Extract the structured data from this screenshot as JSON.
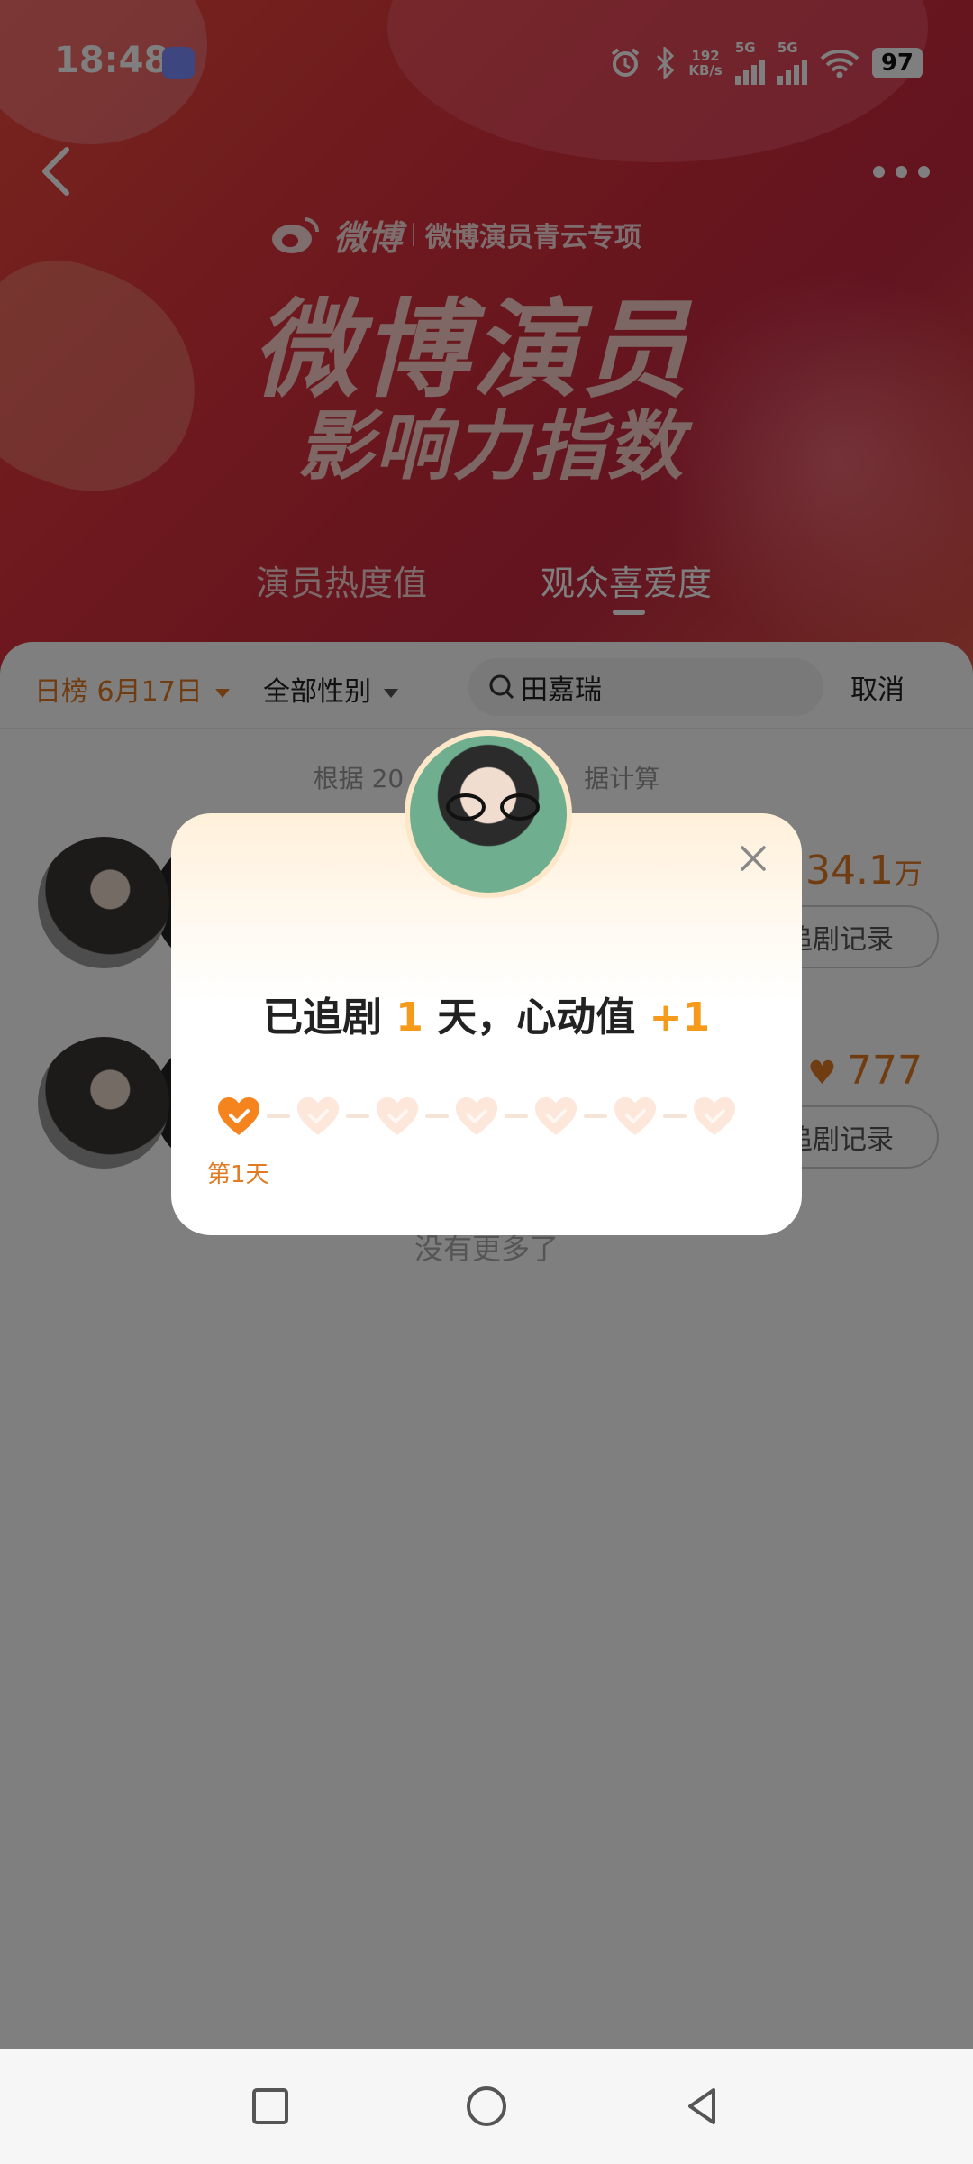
{
  "status_bar": {
    "time": "18:48",
    "network_speed_value": "192",
    "network_speed_unit": "KB/s",
    "signal1_label": "5G",
    "signal2_label": "5G",
    "battery": "97"
  },
  "header": {
    "brand_logo_text": "微博",
    "brand_sub": "微博演员青云专项",
    "title_main": "微博演员",
    "title_sub": "影响力指数",
    "tabs": [
      {
        "label": "演员热度值"
      },
      {
        "label": "观众喜爱度"
      }
    ],
    "active_tab_index": 1
  },
  "filters": {
    "date_label": "日榜 6月17日",
    "gender_label": "全部性别",
    "search_value": "田嘉瑞",
    "cancel_label": "取消"
  },
  "list": {
    "calc_note": "根据 20",
    "calc_note_tail": "据计算",
    "rows": [
      {
        "value": "34.1",
        "unit": "万",
        "record_label": "追剧记录"
      },
      {
        "value": "777",
        "unit": "",
        "record_label": "追剧记录"
      }
    ],
    "no_more_label": "没有更多了"
  },
  "modal": {
    "title_prefix": "已追剧",
    "days": "1",
    "title_middle": "天，心动值",
    "bonus": "+1",
    "progress_total": 7,
    "progress_done": 1,
    "day_label": "第1天"
  },
  "colors": {
    "accent_orange": "#f59a1b",
    "brand_red": "#d9303c",
    "done_heart": "#f5841f",
    "todo_heart": "#fde6da"
  }
}
